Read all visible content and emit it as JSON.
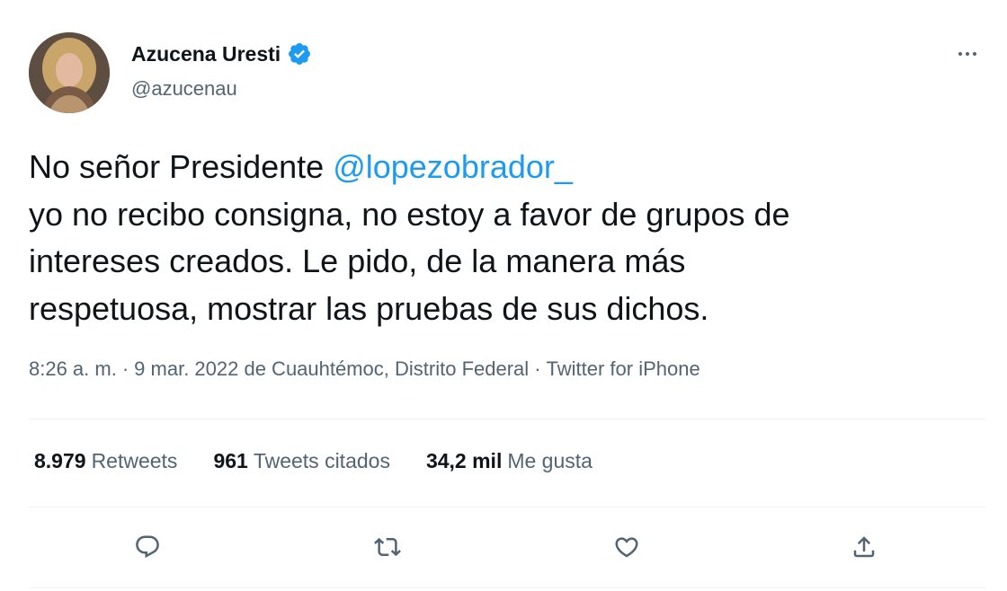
{
  "author": {
    "display_name": "Azucena Uresti",
    "handle": "@azucenau",
    "verified": true
  },
  "tweet": {
    "lines": [
      {
        "text": "No señor Presidente ",
        "mention": "@lopezobrador_"
      },
      {
        "text": "yo no recibo consigna, no estoy a favor de grupos de"
      },
      {
        "text": "intereses creados. Le pido, de la manera más"
      },
      {
        "text": "respetuosa, mostrar las pruebas de sus dichos."
      }
    ],
    "time": "8:26 a. m.",
    "date_location": "9 mar. 2022 de Cuauhtémoc, Distrito Federal",
    "source": "Twitter for iPhone",
    "separator": "·"
  },
  "stats": {
    "retweets": {
      "value": "8.979",
      "label": "Retweets"
    },
    "quotes": {
      "value": "961",
      "label": "Tweets citados"
    },
    "likes": {
      "value": "34,2 mil",
      "label": "Me gusta"
    }
  },
  "colors": {
    "accent": "#1d9bf0",
    "text_primary": "#0f1419",
    "text_secondary": "#536471",
    "divider": "#eff3f4"
  },
  "icons": {
    "reply": "speech-bubble-icon",
    "retweet": "retweet-arrows-icon",
    "like": "heart-icon",
    "share": "share-upload-icon",
    "more": "more-horizontal-icon",
    "verified": "verified-badge-icon"
  }
}
